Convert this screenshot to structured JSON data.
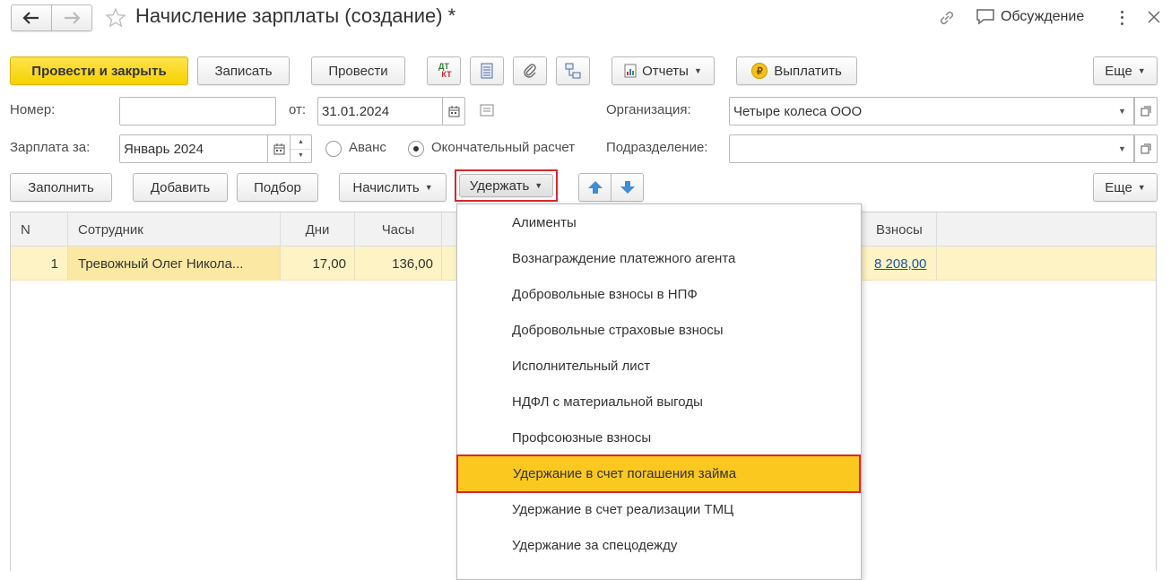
{
  "title": "Начисление зарплаты (создание) *",
  "header": {
    "discussion_label": "Обсуждение"
  },
  "toolbar": {
    "post_close_label": "Провести и закрыть",
    "save_label": "Записать",
    "post_label": "Провести",
    "dtkt_top": "ДТ",
    "dtkt_bottom": "КТ",
    "reports_label": "Отчеты",
    "pay_label": "Выплатить",
    "more_label": "Еще"
  },
  "form": {
    "number_label": "Номер:",
    "number_value": "",
    "from_label": "от:",
    "date_value": "31.01.2024",
    "org_label": "Организация:",
    "org_value": "Четыре колеса ООО",
    "salary_for_label": "Зарплата за:",
    "period_value": "Январь 2024",
    "advance_label": "Аванс",
    "final_label": "Окончательный расчет",
    "selected_option": "final",
    "division_label": "Подразделение:",
    "division_value": ""
  },
  "table_toolbar": {
    "fill_label": "Заполнить",
    "add_label": "Добавить",
    "select_label": "Подбор",
    "accrue_label": "Начислить",
    "withhold_label": "Удержать",
    "more_label": "Еще"
  },
  "table": {
    "headers": {
      "n": "N",
      "employee": "Сотрудник",
      "days": "Дни",
      "hours": "Часы",
      "contributions": "Взносы"
    },
    "rows": [
      {
        "n": "1",
        "employee": "Тревожный Олег Никола...",
        "days": "17,00",
        "hours": "136,00",
        "contributions": "8 208,00"
      }
    ]
  },
  "withhold_menu": {
    "items": [
      "Алименты",
      "Вознаграждение платежного агента",
      "Добровольные взносы в НПФ",
      "Добровольные страховые взносы",
      "Исполнительный лист",
      "НДФЛ с материальной выгоды",
      "Профсоюзные взносы",
      "Удержание в счет погашения займа",
      "Удержание в счет реализации ТМЦ",
      "Удержание за спецодежду"
    ],
    "highlighted_index": 7
  },
  "colors": {
    "accent_yellow": "#f6d100",
    "highlight_red": "#d9272e",
    "row_selected": "#fdf3c4",
    "menu_highlight": "#fac81e",
    "link_blue": "#1a57a6"
  }
}
